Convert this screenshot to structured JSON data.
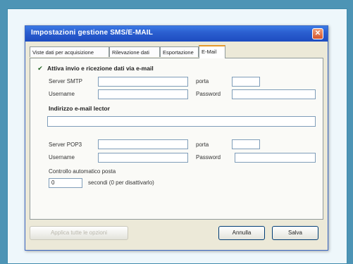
{
  "window": {
    "title": "Impostazioni gestione SMS/E-MAIL"
  },
  "tabs": [
    {
      "label": "Viste dati per acquisizione"
    },
    {
      "label": "Rilevazione dati"
    },
    {
      "label": "Esportazione"
    },
    {
      "label": "E-Mail"
    }
  ],
  "email": {
    "enable_label": "Attiva invio e ricezione dati via e-mail",
    "enabled": true,
    "smtp_label": "Server SMTP",
    "port_label": "porta",
    "username_label": "Username",
    "password_label": "Password",
    "address_section": "Indirizzo e-mail lector",
    "pop3_label": "Server POP3",
    "auto_check_label": "Controllo automatico posta",
    "interval_value": "0",
    "interval_suffix": "secondi (0 per disattivarlo)"
  },
  "buttons": {
    "apply_all": "Applica tutte le opzioni",
    "cancel": "Annulla",
    "save": "Salva"
  }
}
